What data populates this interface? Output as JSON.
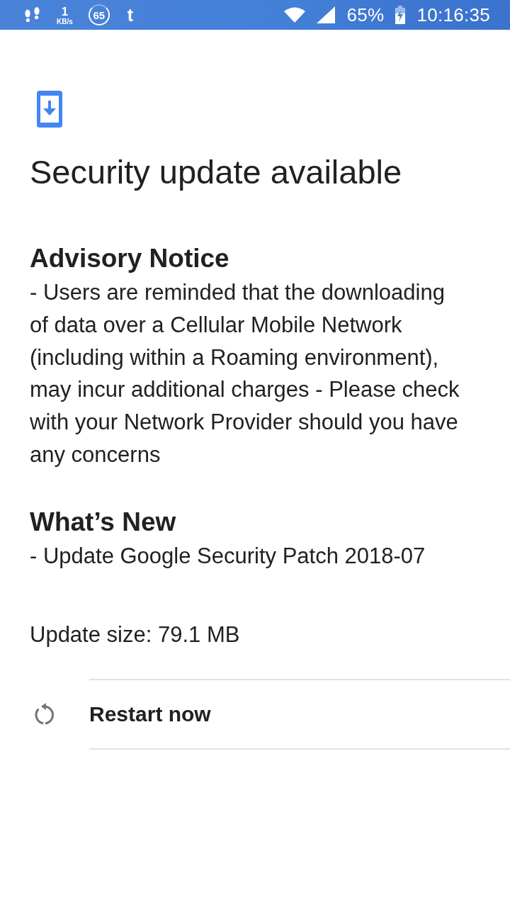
{
  "status_bar": {
    "network_speed": {
      "value": "1",
      "unit": "KB/s"
    },
    "count": "65",
    "app_letter": "t",
    "battery": {
      "percent": "65%",
      "charging": true
    },
    "time": "10:16:35"
  },
  "update": {
    "title": "Security update available",
    "sections": [
      {
        "heading": "Advisory Notice",
        "body": "- Users are reminded that the downloading of data over a Cellular Mobile Network (including within a Roaming environment), may incur additional charges - Please check with your Network Provider should you have any concerns"
      },
      {
        "heading": "What’s New",
        "body": "- Update Google Security Patch 2018-07"
      }
    ],
    "size": "Update size: 79.1 MB",
    "actions": [
      {
        "kind": "restart",
        "label": "Restart now"
      }
    ]
  }
}
